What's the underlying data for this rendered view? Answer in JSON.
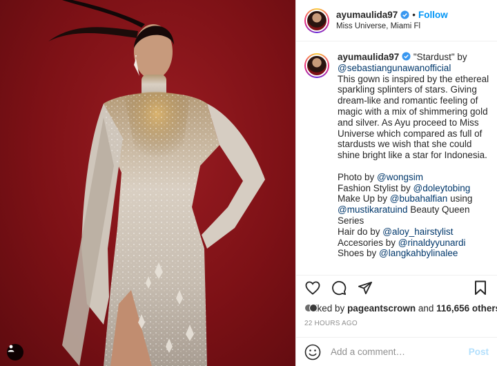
{
  "post": {
    "username": "ayumaulida97",
    "follow_label": "Follow",
    "separator": "•",
    "location": "Miss Universe, Miami Fl"
  },
  "caption": {
    "username": "ayumaulida97",
    "lines": [
      {
        "text": " \"Stardust\" by"
      },
      {
        "mention": "@sebastiangunawanofficial"
      },
      {
        "text": "This gown is inspired by the ethereal"
      },
      {
        "text": "sparkling splinters of stars. Giving"
      },
      {
        "text": "dream-like and romantic feeling of"
      },
      {
        "text": "magic with a mix of shimmering gold"
      },
      {
        "text": "and silver. As Ayu proceed to Miss"
      },
      {
        "text": "Universe which compared as full of"
      },
      {
        "text": "stardusts we wish that she could"
      },
      {
        "text": "shine bright like a star for Indonesia."
      },
      {
        "text": "Photo by ",
        "mention": "@wongsim"
      },
      {
        "text": "Fashion Stylist by ",
        "mention": "@doleytobing"
      },
      {
        "text": "Make Up by ",
        "mention": "@bubahalfian",
        "after": " using"
      },
      {
        "mention": "@mustikaratuind",
        "after": " Beauty Queen"
      },
      {
        "text": "Series"
      },
      {
        "text": "Hair do by ",
        "mention": "@aloy_hairstylist"
      },
      {
        "text": "Accesories by ",
        "mention": "@rinaldyyunardi"
      },
      {
        "text": "Shoes by ",
        "mention": "@langkahbylinalee"
      }
    ]
  },
  "likes": {
    "prefix": "Liked by ",
    "user": "pageantscrown",
    "middle": " and ",
    "count": "116,656 others"
  },
  "timestamp": "22 HOURS AGO",
  "comment_box": {
    "placeholder": "Add a comment…",
    "post_label": "Post"
  },
  "icons": {
    "verified": "verified-badge-icon",
    "like": "heart-icon",
    "comment": "comment-bubble-icon",
    "share": "paper-plane-icon",
    "save": "bookmark-icon",
    "emoji": "smiley-icon",
    "tag": "person-tag-icon"
  },
  "colors": {
    "link_blue": "#0095f6",
    "mention": "#00376b",
    "post_disabled": "#b2dffc",
    "background_red": "#7d1116"
  }
}
